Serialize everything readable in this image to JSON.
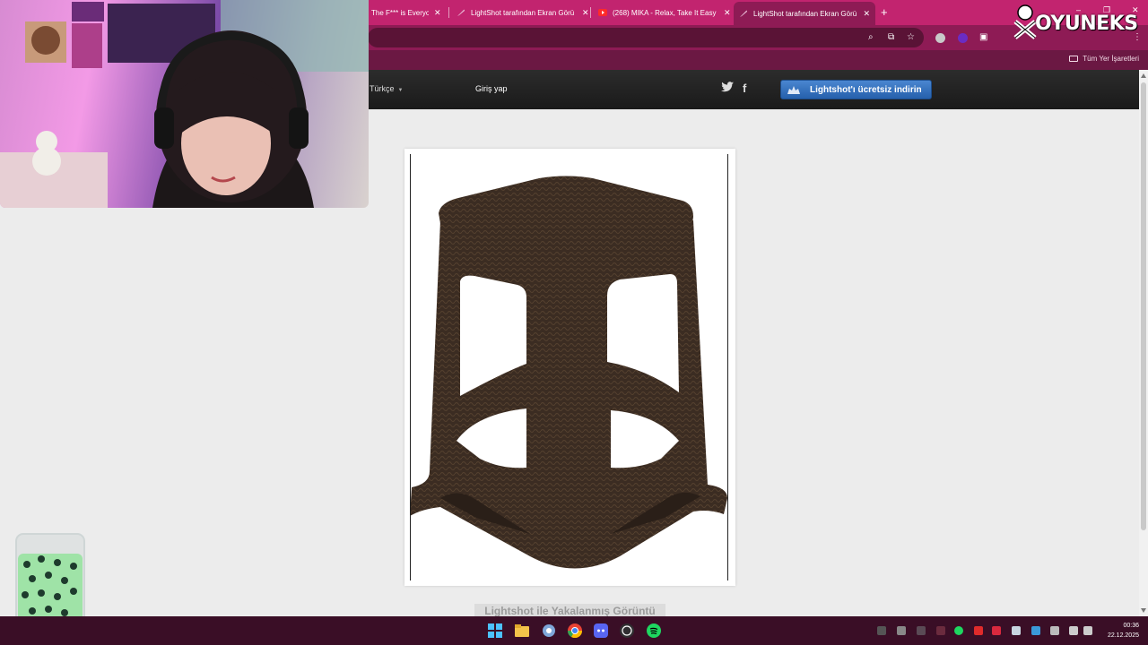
{
  "browser": {
    "tabs": [
      {
        "title": "The F*** is Everyo",
        "icon": "generic-tab-icon",
        "active": false
      },
      {
        "title": "LightShot tarafından Ekran Görü",
        "icon": "lightshot-feather-icon",
        "active": false
      },
      {
        "title": "(268) MIKA - Relax, Take It Easy",
        "icon": "youtube-icon",
        "active": false
      },
      {
        "title": "LightShot tarafından Ekran Görü",
        "icon": "lightshot-feather-icon",
        "active": true
      }
    ],
    "new_tab_symbol": "+",
    "window_controls": [
      "–",
      "❐",
      "✕"
    ],
    "bookmarks": {
      "all_bookmarks_label": "Tüm Yer İşaretleri"
    },
    "theme_color": "#c2246f"
  },
  "site": {
    "language_label": "Türkçe",
    "login_label": "Giriş yap",
    "twitter_glyph": "🐦",
    "facebook_glyph": "f",
    "download_button_label": "Lightshot'ı ücretsiz indirin",
    "caption": "Lightshot ile Yakalanmış Görüntü",
    "image_subject": "brown rattan-pattern plastic stool"
  },
  "overlay": {
    "brand_logo_text": "OYUNEKS"
  },
  "taskbar": {
    "time": "00:36",
    "date": "22.12.2025"
  }
}
